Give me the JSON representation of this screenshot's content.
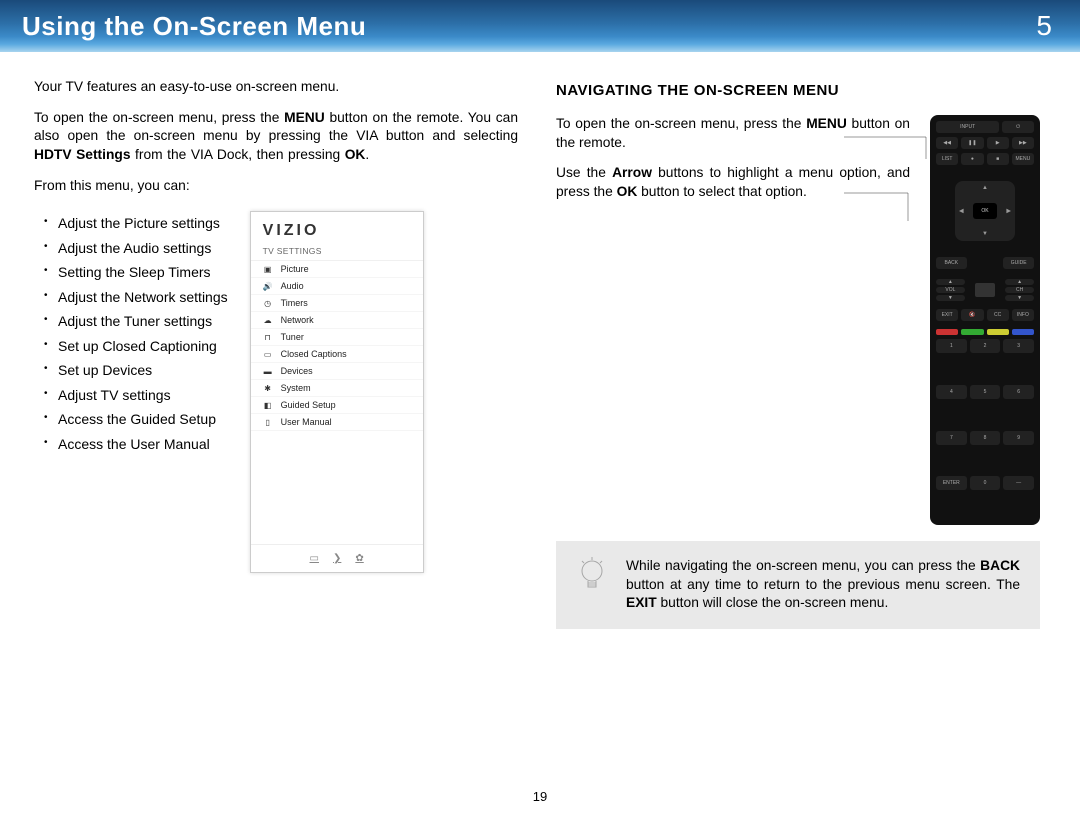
{
  "banner": {
    "title": "Using the On-Screen Menu",
    "chapter": "5"
  },
  "left": {
    "intro1": "Your TV features an easy-to-use on-screen menu.",
    "intro2_a": "To open the on-screen menu, press the ",
    "intro2_b1": "MENU",
    "intro2_c": " button on the remote. You can also open the on-screen menu by pressing the VIA button and selecting ",
    "intro2_b2": "HDTV Settings",
    "intro2_d": " from the VIA Dock, then pressing ",
    "intro2_b3": "OK",
    "intro2_e": ".",
    "intro3": "From this menu, you can:",
    "bullets": [
      "Adjust the Picture settings",
      "Adjust the Audio settings",
      "Setting the Sleep Timers",
      "Adjust the Network settings",
      "Adjust the Tuner settings",
      "Set up Closed Captioning",
      "Set up Devices",
      "Adjust TV settings",
      "Access the Guided Setup",
      "Access the User Manual"
    ],
    "osd": {
      "brand": "VIZIO",
      "title": "TV SETTINGS",
      "items": [
        "Picture",
        "Audio",
        "Timers",
        "Network",
        "Tuner",
        "Closed Captions",
        "Devices",
        "System",
        "Guided Setup",
        "User Manual"
      ]
    }
  },
  "right": {
    "heading": "NAVIGATING THE ON-SCREEN MENU",
    "p1_a": "To open the on-screen menu, press the ",
    "p1_b": "MENU",
    "p1_c": " button on the remote.",
    "p2_a": "Use the ",
    "p2_b1": "Arrow",
    "p2_c": " buttons to highlight a menu option, and press the ",
    "p2_b2": "OK",
    "p2_d": " button to select that option.",
    "remote": {
      "labels": {
        "input": "INPUT",
        "list": "LIST",
        "menu": "MENU",
        "back": "BACK",
        "guide": "GUIDE",
        "ok": "OK",
        "vol": "VOL",
        "ch": "CH",
        "exit": "EXIT",
        "info": "INFO",
        "cc": "CC",
        "enter": "ENTER"
      },
      "numbers": [
        "1",
        "2",
        "3",
        "4",
        "5",
        "6",
        "7",
        "8",
        "9",
        "",
        "0",
        "—"
      ]
    },
    "tip_a": "While navigating the on-screen menu, you can press the ",
    "tip_b1": "BACK",
    "tip_c": " button at any time to return to the previous menu screen. The ",
    "tip_b2": "EXIT",
    "tip_d": " button will close the on-screen menu."
  },
  "page_number": "19"
}
